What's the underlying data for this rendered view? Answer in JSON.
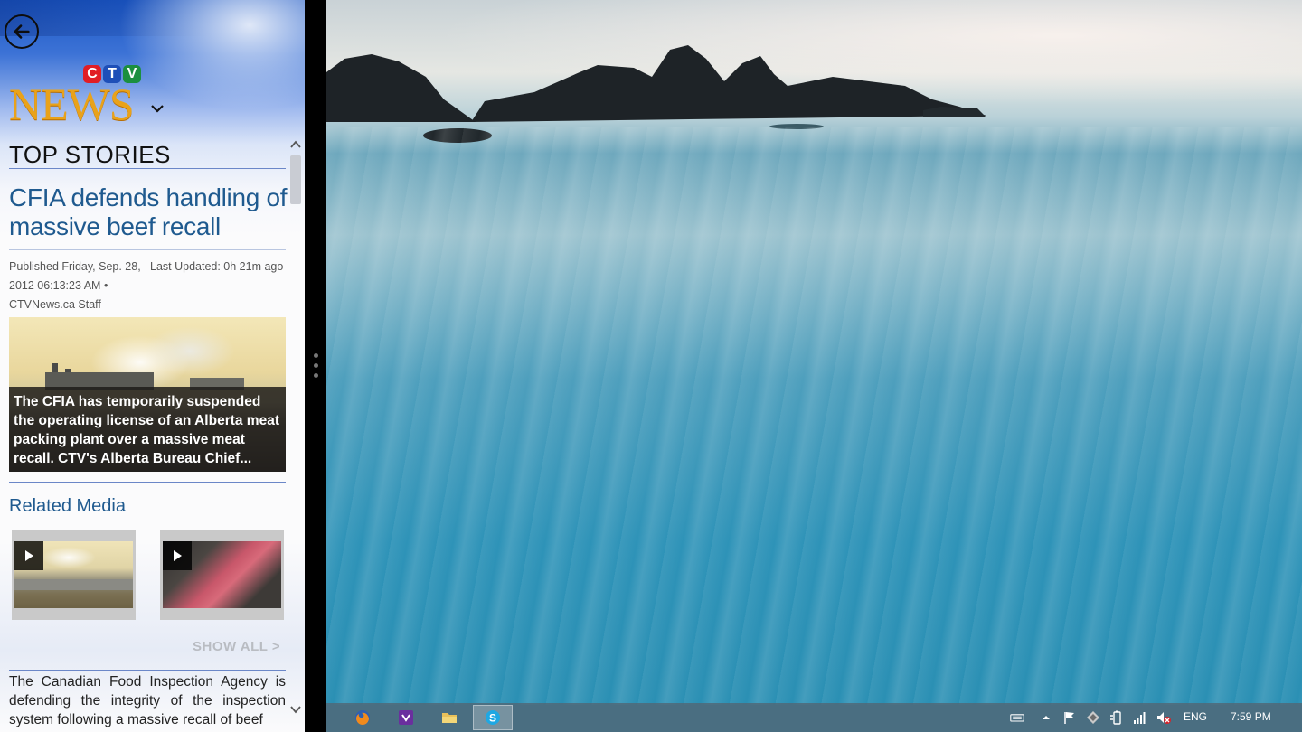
{
  "app": {
    "logo": {
      "ctv": [
        "C",
        "T",
        "V"
      ],
      "news": "NEWS"
    },
    "section_title": "TOP STORIES",
    "story": {
      "headline": "CFIA defends handling of massive beef recall",
      "published": "Published Friday, Sep. 28, 2012 06:13:23 AM •",
      "last_updated": "Last Updated:  0h 21m ago",
      "author": "CTVNews.ca Staff",
      "caption": "The CFIA has temporarily suspended the operating license of an Alberta meat packing plant over a massive meat recall. CTV's Alberta Bureau Chief...",
      "body": "The Canadian Food Inspection Agency is defending the integrity of the inspection system following a massive recall of beef"
    },
    "related": {
      "title": "Related Media",
      "show_all": "SHOW ALL >"
    }
  },
  "taskbar": {
    "apps": [
      {
        "name": "firefox-icon",
        "active": false
      },
      {
        "name": "visual-studio-icon",
        "active": false
      },
      {
        "name": "file-explorer-icon",
        "active": false
      },
      {
        "name": "skype-icon",
        "active": true
      }
    ],
    "tray": {
      "language": "ENG",
      "time": "7:59 PM"
    }
  },
  "colors": {
    "accent_blue": "#1f5a8f",
    "ctv_red": "#e11d25",
    "ctv_blue": "#1e4fb8",
    "ctv_green": "#1c8f3f",
    "news_gold": "#e9a21a"
  }
}
